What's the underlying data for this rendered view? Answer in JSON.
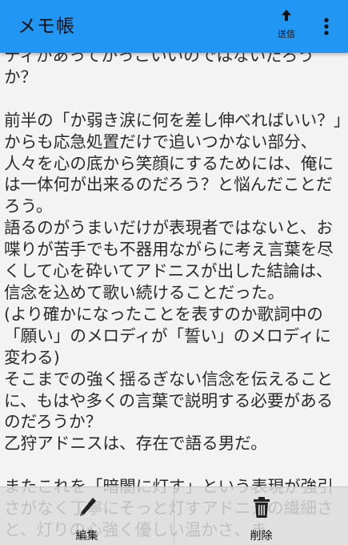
{
  "app_bar": {
    "title": "メモ帳",
    "send_label": "送信",
    "send_icon": "arrow-up-icon",
    "menu_icon": "vertical-ellipsis-icon",
    "background": "#2196f3"
  },
  "memo": {
    "text": "ティがあってかっこいいのではないだろうか？\n\n前半の「か弱き涙に何を差し伸べればいい？」からも応急処置だけで追いつかない部分、人々を心の底から笑顔にするためには、俺には一体何が出来るのだろう？と悩んだことだろう。\n語るのがうまいだけが表現者ではないと、お喋りが苦手でも不器用ながらに考え言葉を尽くして心を砕いてアドニスが出した結論は、信念を込めて歌い続けることだった。\n(より確かになったことを表すのか歌詞中の「願い」のメロディが「誓い」のメロディに変わる)\nそこまでの強く揺るぎない信念を伝えることに、もはや多くの言葉で説明する必要があるのだろうか？\n乙狩アドニスは、存在で語る男だ。\n\nまたこれを「暗闇に灯す」という表現が強引さがなく丁寧にそっと灯すアドニスの繊細さと、灯りの心強く優しい温かさ、ま"
  },
  "bottom_bar": {
    "edit_label": "編集",
    "edit_icon": "pencil-icon",
    "delete_label": "削除",
    "delete_icon": "trash-icon"
  }
}
